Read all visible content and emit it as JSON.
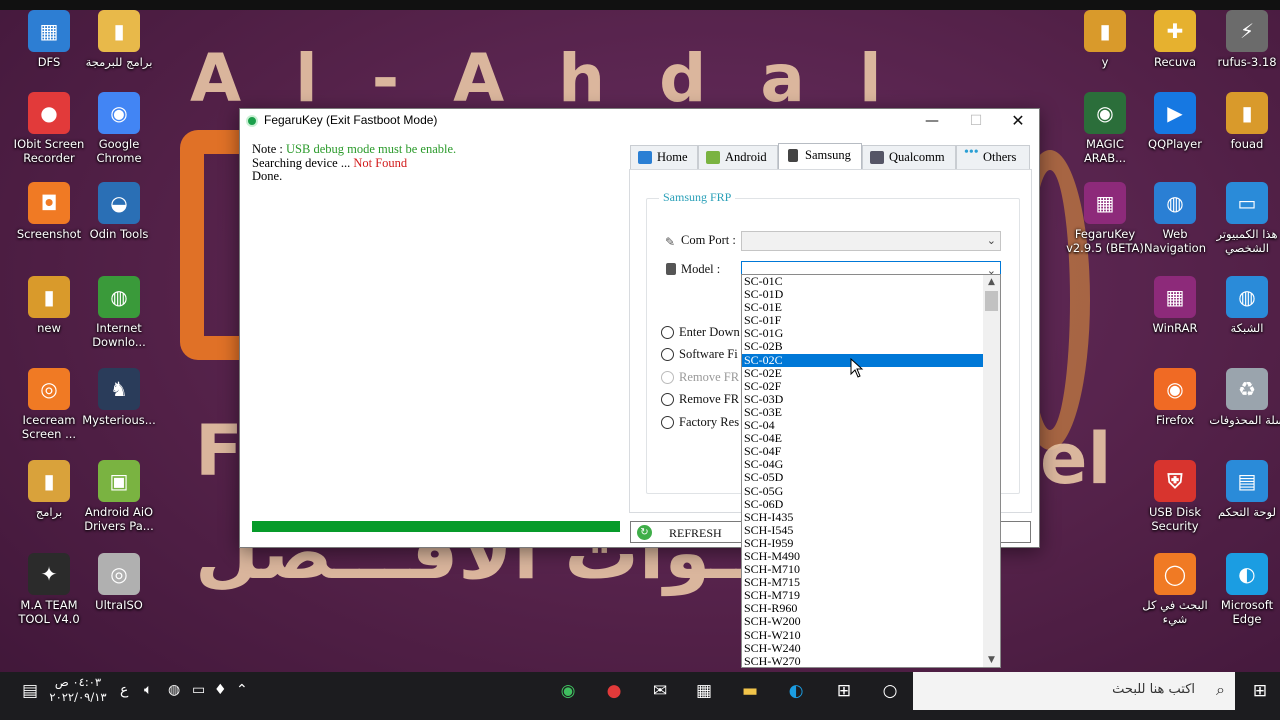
{
  "desktop": {
    "watermark_title": "Al-Ahdal",
    "watermark_sub_left": "F",
    "watermark_sub_right": "el",
    "watermark_arabic": "قنــوات الافـــضل",
    "icons_left": [
      {
        "label": "DFS",
        "color": "#2d7ed3",
        "glyph": "▦"
      },
      {
        "label": "برامج للبرمجة",
        "color": "#e8b94a",
        "glyph": "▮"
      },
      {
        "label": "IObit Screen Recorder",
        "color": "#e23a3a",
        "glyph": "●"
      },
      {
        "label": "Google Chrome",
        "color": "#4285f4",
        "glyph": "◉"
      },
      {
        "label": "Screenshot",
        "color": "#f07a24",
        "glyph": "◘"
      },
      {
        "label": "Odin Tools",
        "color": "#2a6fb5",
        "glyph": "◒"
      },
      {
        "label": "new",
        "color": "#d99a2b",
        "glyph": "▮"
      },
      {
        "label": "Internet Downlo...",
        "color": "#3a9a3a",
        "glyph": "◍"
      },
      {
        "label": "Icecream Screen ...",
        "color": "#f07a24",
        "glyph": "◎"
      },
      {
        "label": "Mysterious...",
        "color": "#2a3c5a",
        "glyph": "♞"
      },
      {
        "label": "برامج",
        "color": "#d9a23b",
        "glyph": "▮"
      },
      {
        "label": "Android AiO Drivers Pa...",
        "color": "#7ab341",
        "glyph": "▣"
      },
      {
        "label": "M.A TEAM TOOL V4.0",
        "color": "#2b2b2b",
        "glyph": "✦"
      },
      {
        "label": "UltraISO",
        "color": "#b0b0b0",
        "glyph": "◎"
      }
    ],
    "icons_right": [
      {
        "label": "y",
        "color": "#d99a2b",
        "glyph": "▮"
      },
      {
        "label": "Recuva",
        "color": "#e6b12f",
        "glyph": "✚"
      },
      {
        "label": "rufus-3.18",
        "color": "#6b6b6b",
        "glyph": "⚡"
      },
      {
        "label": "MAGIC ARAB...",
        "color": "#2b6e3a",
        "glyph": "◉"
      },
      {
        "label": "QQPlayer",
        "color": "#1678e2",
        "glyph": "▶"
      },
      {
        "label": "fouad",
        "color": "#d99a2b",
        "glyph": "▮"
      },
      {
        "label": "FegaruKey v2.9.5 (BETA)",
        "color": "#8d2a7a",
        "glyph": "▦"
      },
      {
        "label": "Web Navigation",
        "color": "#2a7fd4",
        "glyph": "◍"
      },
      {
        "label": "هذا الكمبيوتر الشخصي",
        "color": "#2a8bd9",
        "glyph": "▭"
      },
      {
        "label": "WinRAR",
        "color": "#8d2a7a",
        "glyph": "▦"
      },
      {
        "label": "الشبكة",
        "color": "#2a8bd9",
        "glyph": "◍"
      },
      {
        "label": "Firefox",
        "color": "#f06a24",
        "glyph": "◉"
      },
      {
        "label": "سلة المحذوفات",
        "color": "#9aa4ad",
        "glyph": "♻"
      },
      {
        "label": "USB Disk Security",
        "color": "#d8342e",
        "glyph": "⛨"
      },
      {
        "label": "لوحة التحكم",
        "color": "#2a8bd9",
        "glyph": "▤"
      },
      {
        "label": "البحث في كل شيء",
        "color": "#f07a24",
        "glyph": "◯"
      },
      {
        "label": "Microsoft Edge",
        "color": "#1b9de2",
        "glyph": "◐"
      }
    ]
  },
  "window": {
    "title": "FegaruKey (Exit Fastboot Mode)",
    "minimize": "—",
    "maximize": "☐",
    "close": "✕",
    "log": {
      "note_prefix": "Note : ",
      "note_text": "USB debug mode must be enable.",
      "searching_prefix": "Searching device ... ",
      "searching_status": "Not Found",
      "done": "Done."
    },
    "progress": 1.0,
    "tabs": [
      {
        "label": "Home",
        "icon": "home-icon",
        "color": "#2a7fd4"
      },
      {
        "label": "Android",
        "icon": "android-icon",
        "color": "#7ab341"
      },
      {
        "label": "Samsung",
        "icon": "phone-icon",
        "color": "#444"
      },
      {
        "label": "Qualcomm",
        "icon": "chip-icon",
        "color": "#556"
      },
      {
        "label": "Others",
        "icon": "dots-icon",
        "color": "#2a9fd4"
      }
    ],
    "group_title": "Samsung FRP",
    "com_port_label": "Com Port :",
    "model_label": "Model :",
    "radios": [
      {
        "label": "Enter Down",
        "disabled": false
      },
      {
        "label": "Software Fi",
        "disabled": false
      },
      {
        "label": "Remove FR",
        "disabled": true
      },
      {
        "label": "Remove FR",
        "disabled": false
      },
      {
        "label": "Factory Res",
        "disabled": false
      }
    ],
    "refresh_label": "REFRESH"
  },
  "dropdown": {
    "selected": "SC-02C",
    "items": [
      "SC-01C",
      "SC-01D",
      "SC-01E",
      "SC-01F",
      "SC-01G",
      "SC-02B",
      "SC-02C",
      "SC-02E",
      "SC-02F",
      "SC-03D",
      "SC-03E",
      "SC-04",
      "SC-04E",
      "SC-04F",
      "SC-04G",
      "SC-05D",
      "SC-05G",
      "SC-06D",
      "SCH-I435",
      "SCH-I545",
      "SCH-I959",
      "SCH-M490",
      "SCH-M710",
      "SCH-M715",
      "SCH-M719",
      "SCH-R960",
      "SCH-W200",
      "SCH-W210",
      "SCH-W240",
      "SCH-W270"
    ]
  },
  "taskbar": {
    "clock_time": "٠٤:٠٣ ص",
    "clock_date": "٢٠٢٢/٠٩/١٣",
    "lang": "ع",
    "search_placeholder": "اكتب هنا للبحث"
  }
}
